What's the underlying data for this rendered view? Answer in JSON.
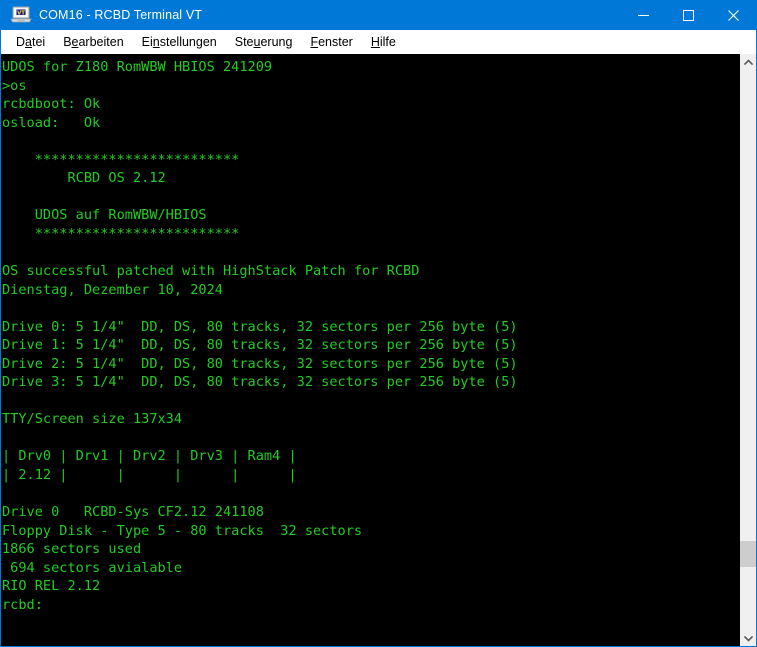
{
  "window": {
    "title": "COM16 - RCBD Terminal VT",
    "icon": "vt-terminal-icon",
    "icon_badge": "VT",
    "accent_color": "#0078d7",
    "controls": {
      "minimize": "Minimieren",
      "maximize": "Maximieren",
      "close": "Schließen"
    }
  },
  "menubar": {
    "items": [
      {
        "label": "Datei",
        "pre": "D",
        "mnemonic": "a",
        "post": "tei"
      },
      {
        "label": "Bearbeiten",
        "pre": "B",
        "mnemonic": "e",
        "post": "arbeiten"
      },
      {
        "label": "Einstellungen",
        "pre": "Ei",
        "mnemonic": "n",
        "post": "stellungen"
      },
      {
        "label": "Steuerung",
        "pre": "Ste",
        "mnemonic": "u",
        "post": "erung"
      },
      {
        "label": "Fenster",
        "pre": "",
        "mnemonic": "F",
        "post": "enster"
      },
      {
        "label": "Hilfe",
        "pre": "",
        "mnemonic": "H",
        "post": "ilfe"
      }
    ]
  },
  "terminal": {
    "foreground_color": "#22cc22",
    "background_color": "#000000",
    "prompt": "rcbd:",
    "lines": [
      "UDOS for Z180 RomWBW HBIOS 241209",
      ">os",
      "rcbdboot: Ok",
      "osload:   Ok",
      "",
      "    *************************",
      "        RCBD OS 2.12",
      "",
      "    UDOS auf RomWBW/HBIOS",
      "    *************************",
      "",
      "OS successful patched with HighStack Patch for RCBD",
      "Dienstag, Dezember 10, 2024",
      "",
      "Drive 0: 5 1/4\"  DD, DS, 80 tracks, 32 sectors per 256 byte (5)",
      "Drive 1: 5 1/4\"  DD, DS, 80 tracks, 32 sectors per 256 byte (5)",
      "Drive 2: 5 1/4\"  DD, DS, 80 tracks, 32 sectors per 256 byte (5)",
      "Drive 3: 5 1/4\"  DD, DS, 80 tracks, 32 sectors per 256 byte (5)",
      "",
      "TTY/Screen size 137x34",
      "",
      "| Drv0 | Drv1 | Drv2 | Drv3 | Ram4 |",
      "| 2.12 |      |      |      |      |",
      "",
      "Drive 0   RCBD-Sys CF2.12 241108",
      "Floppy Disk - Type 5 - 80 tracks  32 sectors",
      "1866 sectors used",
      " 694 sectors avialable",
      "RIO REL 2.12",
      "rcbd:"
    ],
    "details": {
      "os_banner": "UDOS for Z180 RomWBW HBIOS 241209",
      "command_entered": "os",
      "boot_status_rcbdboot": "Ok",
      "boot_status_osload": "Ok",
      "os_name": "RCBD OS 2.12",
      "os_subtitle": "UDOS auf RomWBW/HBIOS",
      "patch_message": "OS successful patched with HighStack Patch for RCBD",
      "date": "Dienstag, Dezember 10, 2024",
      "tty_screen_size": "137x34",
      "drive_table_headers": [
        "Drv0",
        "Drv1",
        "Drv2",
        "Drv3",
        "Ram4"
      ],
      "drive_table_values": [
        "2.12",
        "",
        "",
        "",
        ""
      ],
      "drive0_info": "RCBD-Sys CF2.12 241108",
      "floppy_info": "Floppy Disk - Type 5 - 80 tracks  32 sectors",
      "sectors_used": "1866 sectors used",
      "sectors_available": "694 sectors avialable",
      "rio_version": "RIO REL 2.12",
      "drives": [
        {
          "name": "Drive 0",
          "size": "5 1/4\"",
          "density": "DD",
          "sides": "DS",
          "tracks": "80 tracks",
          "sectors": "32 sectors per 256 byte",
          "type": "(5)"
        },
        {
          "name": "Drive 1",
          "size": "5 1/4\"",
          "density": "DD",
          "sides": "DS",
          "tracks": "80 tracks",
          "sectors": "32 sectors per 256 byte",
          "type": "(5)"
        },
        {
          "name": "Drive 2",
          "size": "5 1/4\"",
          "density": "DD",
          "sides": "DS",
          "tracks": "80 tracks",
          "sectors": "32 sectors per 256 byte",
          "type": "(5)"
        },
        {
          "name": "Drive 3",
          "size": "5 1/4\"",
          "density": "DD",
          "sides": "DS",
          "tracks": "80 tracks",
          "sectors": "32 sectors per 256 byte",
          "type": "(5)"
        }
      ]
    }
  },
  "scrollbar": {
    "up_arrow": "scroll-up-icon",
    "down_arrow": "scroll-down-icon",
    "thumb": "scroll-thumb"
  }
}
